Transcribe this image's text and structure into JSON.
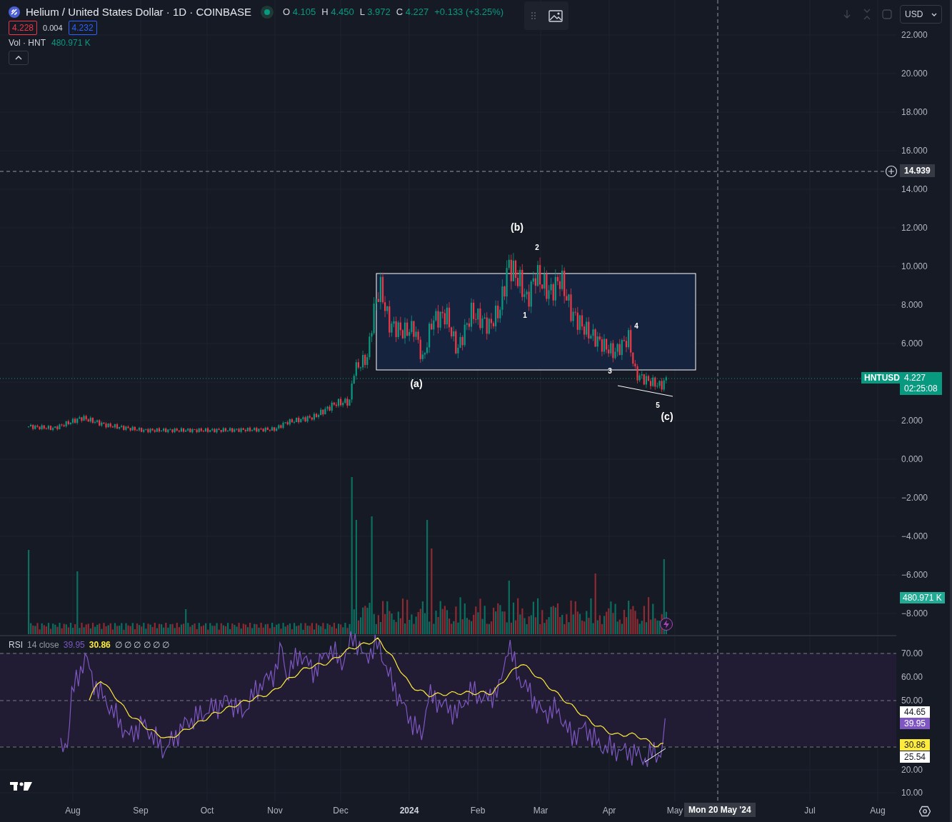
{
  "legend": {
    "symbol": "Helium / United States Dollar · 1D · COINBASE",
    "market_open": true,
    "ohlc": [
      {
        "key": "O",
        "value": "4.105"
      },
      {
        "key": "H",
        "value": "4.450"
      },
      {
        "key": "L",
        "value": "3.972"
      },
      {
        "key": "C",
        "value": "4.227"
      }
    ],
    "change": "+0.133 (+3.25%)",
    "bid": "4.228",
    "spread": "0.004",
    "ask": "4.232",
    "volume_label": "Vol · HNT",
    "volume_value": "480.971 K"
  },
  "currency": "USD",
  "price_axis": [
    "22.000",
    "20.000",
    "18.000",
    "16.000",
    "14.000",
    "12.000",
    "10.000",
    "8.000",
    "6.000",
    "2.000",
    "0.000",
    "−2.000",
    "−4.000",
    "−6.000",
    "−8.000"
  ],
  "crosshair": {
    "price": "14.939",
    "date": "Mon 20 May '24"
  },
  "last_price": {
    "symbol": "HNTUSD",
    "price": "4.227",
    "countdown": "02:25:08"
  },
  "volume_marker": "480.971 K",
  "wave_labels": [
    {
      "text": "(b)"
    },
    {
      "text": "(a)"
    },
    {
      "text": "(c)"
    },
    {
      "text": "1"
    },
    {
      "text": "2"
    },
    {
      "text": "3"
    },
    {
      "text": "4"
    },
    {
      "text": "5"
    }
  ],
  "rsi": {
    "name": "RSI",
    "params": "14 close",
    "value": "39.95",
    "ma": "30.86",
    "extras": "∅ ∅ ∅ ∅ ∅ ∅",
    "axis": [
      "70.00",
      "60.00",
      "50.00",
      "20.00",
      "10.00"
    ],
    "markers": [
      {
        "text": "44.65",
        "color": "#ffffff"
      },
      {
        "text": "39.95",
        "color": "#7e57c2"
      },
      {
        "text": "30.86",
        "color": "#ffeb3b"
      },
      {
        "text": "25.54",
        "color": "#ffffff"
      }
    ]
  },
  "time_axis": [
    {
      "text": "Aug",
      "kind": "month"
    },
    {
      "text": "Sep",
      "kind": "month"
    },
    {
      "text": "Oct",
      "kind": "month"
    },
    {
      "text": "Nov",
      "kind": "month"
    },
    {
      "text": "Dec",
      "kind": "month"
    },
    {
      "text": "2024",
      "kind": "year"
    },
    {
      "text": "Feb",
      "kind": "month"
    },
    {
      "text": "Mar",
      "kind": "month"
    },
    {
      "text": "Apr",
      "kind": "month"
    },
    {
      "text": "May",
      "kind": "month"
    },
    {
      "text": "Jul",
      "kind": "month"
    },
    {
      "text": "Aug",
      "kind": "month"
    }
  ]
}
